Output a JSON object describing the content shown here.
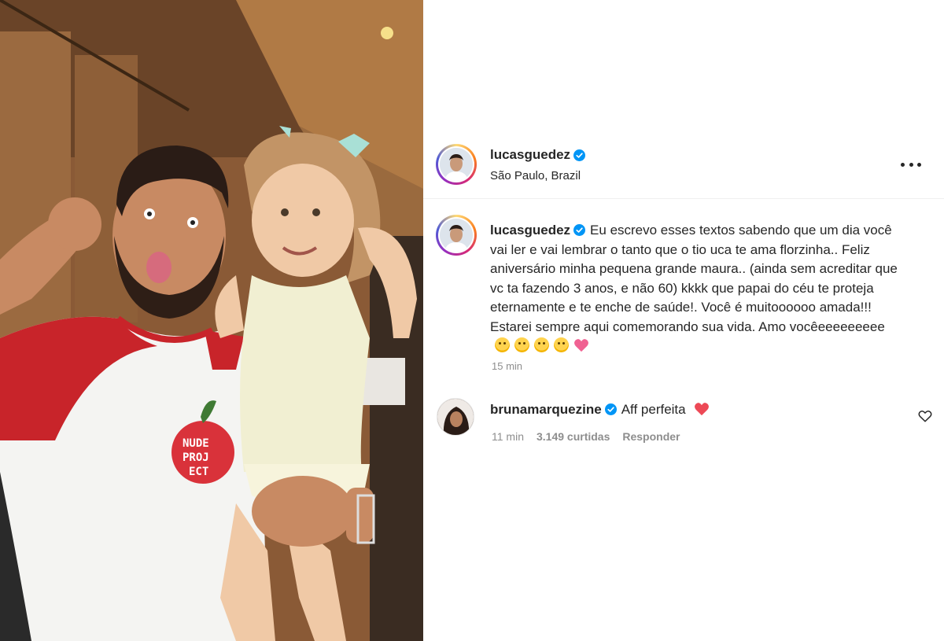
{
  "post": {
    "author": {
      "username": "lucasguedez",
      "verified": true,
      "location": "São Paulo, Brazil",
      "avatar_icon": "profile-avatar"
    },
    "more_icon": "more-horizontal-icon",
    "caption": {
      "username": "lucasguedez",
      "text": "Eu escrevo esses textos sabendo que um dia você vai ler e vai lembrar o tanto que o tio uca te ama florzinha.. Feliz aniversário minha pequena grande maura.. (ainda sem acreditar que vc ta fazendo 3 anos, e não 60) kkkk que papai do céu te proteja eternamente e te enche de saúde!. Você é muitoooooo amada!!! Estarei sempre aqui comemorando sua vida. Amo vocêeeeeeeeee",
      "trailing_emojis": [
        "pleading-face-emoji",
        "pleading-face-emoji",
        "pleading-face-emoji",
        "pleading-face-emoji",
        "sparkling-heart-emoji"
      ],
      "time": "15 min"
    },
    "comments": [
      {
        "username": "bruna­marquezine",
        "verified": true,
        "text": "Aff perfeita",
        "trailing_emoji": "red-heart-emoji",
        "time": "11 min",
        "likes": "3.149 curtidas",
        "reply_label": "Responder",
        "like_icon": "heart-outline-icon"
      }
    ]
  },
  "colors": {
    "text": "#262626",
    "secondary": "#8e8e8e",
    "verified_blue": "#0095f6",
    "heart_red": "#ed4956"
  }
}
